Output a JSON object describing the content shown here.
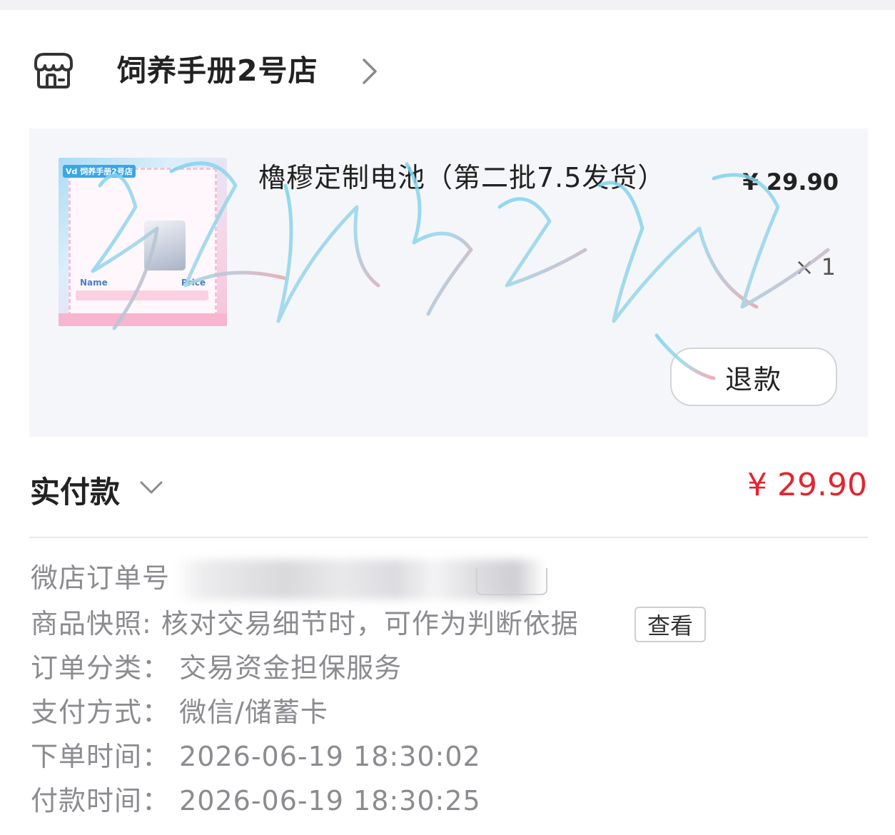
{
  "store": {
    "name": "饲养手册2号店",
    "icon": "store-icon"
  },
  "product": {
    "title": "櫓穆定制电池（第二批7.5发货）",
    "price": "¥ 29.90",
    "quantity": "× 1",
    "refund_label": "退款",
    "thumbnail": {
      "tag": "Vd 饲养手册2号店",
      "name_label": "Name",
      "price_label": "Price"
    }
  },
  "payment": {
    "label": "实付款",
    "amount": "¥ 29.90"
  },
  "details": {
    "order_no_label": "微店订单号",
    "snapshot_label": "商品快照:",
    "snapshot_text": "核对交易细节时，可作为判断依据",
    "snapshot_button": "查看",
    "category_label": "订单分类：",
    "category_value": "交易资金担保服务",
    "pay_method_label": "支付方式：",
    "pay_method_value": "微信/储蓄卡",
    "order_time_label": "下单时间：",
    "order_time_value": "2026-06-19 18:30:02",
    "pay_time_label": "付款时间：",
    "pay_time_value": "2026-06-19 18:30:25"
  },
  "colors": {
    "accent_red": "#e5242e",
    "card_bg": "#f5f6f9",
    "muted_text": "#8b8b90"
  }
}
